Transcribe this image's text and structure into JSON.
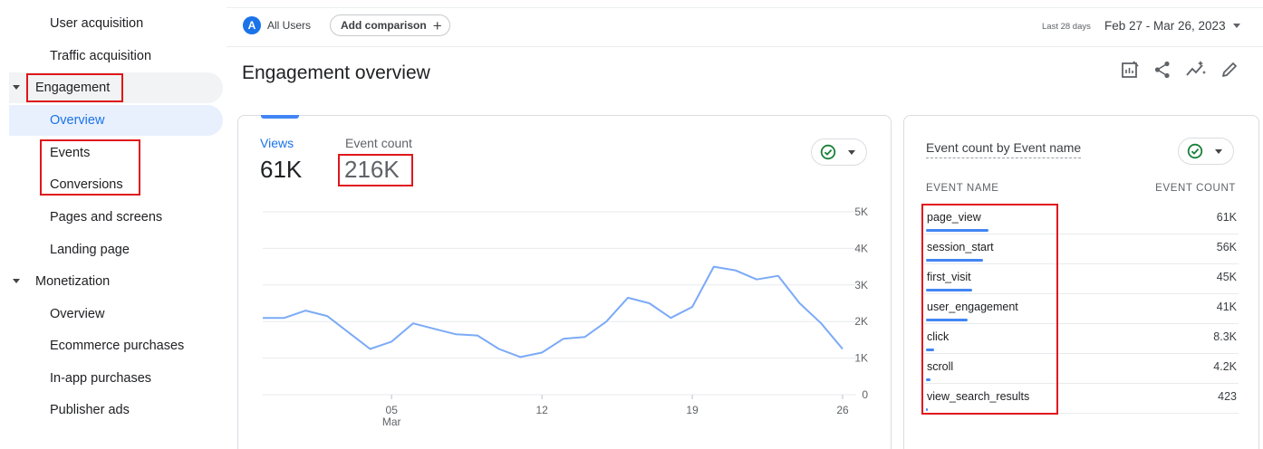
{
  "sidebar": {
    "items": [
      {
        "label": "User acquisition"
      },
      {
        "label": "Traffic acquisition"
      },
      {
        "label": "Engagement"
      },
      {
        "label": "Overview"
      },
      {
        "label": "Events"
      },
      {
        "label": "Conversions"
      },
      {
        "label": "Pages and screens"
      },
      {
        "label": "Landing page"
      },
      {
        "label": "Monetization"
      },
      {
        "label": "Overview"
      },
      {
        "label": "Ecommerce purchases"
      },
      {
        "label": "In-app purchases"
      },
      {
        "label": "Publisher ads"
      }
    ]
  },
  "topbar": {
    "segment_letter": "A",
    "segment_label": "All Users",
    "add_comparison": "Add comparison",
    "date_caption": "Last 28 days",
    "date_range": "Feb 27 - Mar 26, 2023"
  },
  "page": {
    "title": "Engagement overview"
  },
  "metrics": {
    "views_label": "Views",
    "views_value": "61K",
    "events_label": "Event count",
    "events_value": "216K"
  },
  "chart_data": {
    "type": "line",
    "x_ticks": [
      "05",
      "12",
      "19",
      "26"
    ],
    "x_tick_sub": "Mar",
    "y_ticks": [
      "0",
      "1K",
      "2K",
      "3K",
      "4K",
      "5K"
    ],
    "ylim": [
      0,
      5000
    ],
    "x": [
      "Feb 27",
      "Feb 28",
      "Mar 1",
      "Mar 2",
      "Mar 3",
      "Mar 4",
      "Mar 5",
      "Mar 6",
      "Mar 7",
      "Mar 8",
      "Mar 9",
      "Mar 10",
      "Mar 11",
      "Mar 12",
      "Mar 13",
      "Mar 14",
      "Mar 15",
      "Mar 16",
      "Mar 17",
      "Mar 18",
      "Mar 19",
      "Mar 20",
      "Mar 21",
      "Mar 22",
      "Mar 23",
      "Mar 24",
      "Mar 25",
      "Mar 26"
    ],
    "series": [
      {
        "values": [
          2100,
          2100,
          2300,
          2150,
          1700,
          1250,
          1450,
          1950,
          1800,
          1650,
          1620,
          1250,
          1030,
          1150,
          1530,
          1580,
          2000,
          2650,
          2500,
          2100,
          2400,
          3500,
          3400,
          3150,
          3250,
          2500,
          1950,
          1250
        ]
      }
    ],
    "color": "#7baaf7"
  },
  "side_card": {
    "title": "Event count by Event name",
    "col_name": "EVENT NAME",
    "col_count": "EVENT COUNT",
    "rows": [
      {
        "name": "page_view",
        "count": "61K",
        "value": 61000
      },
      {
        "name": "session_start",
        "count": "56K",
        "value": 56000
      },
      {
        "name": "first_visit",
        "count": "45K",
        "value": 45000
      },
      {
        "name": "user_engagement",
        "count": "41K",
        "value": 41000
      },
      {
        "name": "click",
        "count": "8.3K",
        "value": 8300
      },
      {
        "name": "scroll",
        "count": "4.2K",
        "value": 4200
      },
      {
        "name": "view_search_results",
        "count": "423",
        "value": 423
      }
    ]
  },
  "colors": {
    "accent": "#1a73e8",
    "line": "#7baaf7",
    "highlight": "#e0161b"
  }
}
